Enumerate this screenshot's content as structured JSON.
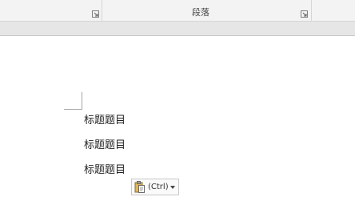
{
  "ribbon": {
    "paragraph_group_label": "段落"
  },
  "document": {
    "paragraphs": [
      "标题题目",
      "标题题目",
      "标题题目"
    ]
  },
  "paste_options": {
    "label": "(Ctrl)",
    "icon": "clipboard-icon"
  },
  "colors": {
    "ribbon_bg": "#f3f3f3",
    "strip_bg": "#e6e6e6",
    "text": "#222222"
  }
}
